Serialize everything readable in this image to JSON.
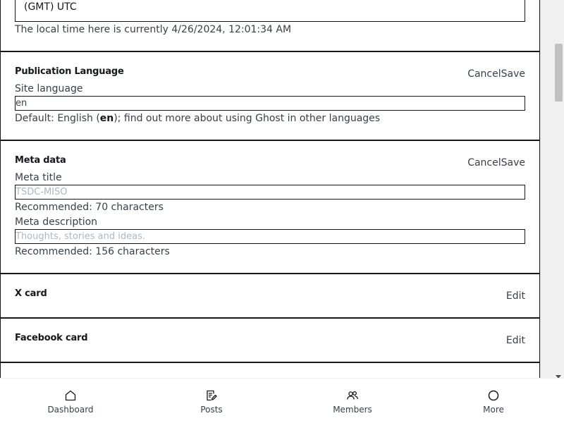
{
  "timezone": {
    "selected_value": "(GMT) UTC",
    "local_time_text": "The local time here is currently 4/26/2024, 12:01:34 AM"
  },
  "publication_language": {
    "title": "Publication Language",
    "cancel_label": "Cancel",
    "save_label": "Save",
    "field_label": "Site language",
    "field_value": "en",
    "hint_prefix": "Default: English (",
    "hint_code": "en",
    "hint_suffix": "); find out more about using Ghost in other languages"
  },
  "meta_data": {
    "title": "Meta data",
    "cancel_label": "Cancel",
    "save_label": "Save",
    "meta_title_label": "Meta title",
    "meta_title_placeholder": "TSDC-MISO",
    "meta_title_hint": "Recommended: 70 characters",
    "meta_description_label": "Meta description",
    "meta_description_placeholder": "Thoughts, stories and ideas.",
    "meta_description_hint": "Recommended: 156 characters"
  },
  "x_card": {
    "title": "X card",
    "edit_label": "Edit"
  },
  "facebook_card": {
    "title": "Facebook card",
    "edit_label": "Edit"
  },
  "bottom_nav": {
    "items": [
      {
        "label": "Dashboard",
        "icon": "home-icon"
      },
      {
        "label": "Posts",
        "icon": "posts-icon"
      },
      {
        "label": "Members",
        "icon": "members-icon"
      },
      {
        "label": "More",
        "icon": "more-circle-icon"
      }
    ]
  }
}
